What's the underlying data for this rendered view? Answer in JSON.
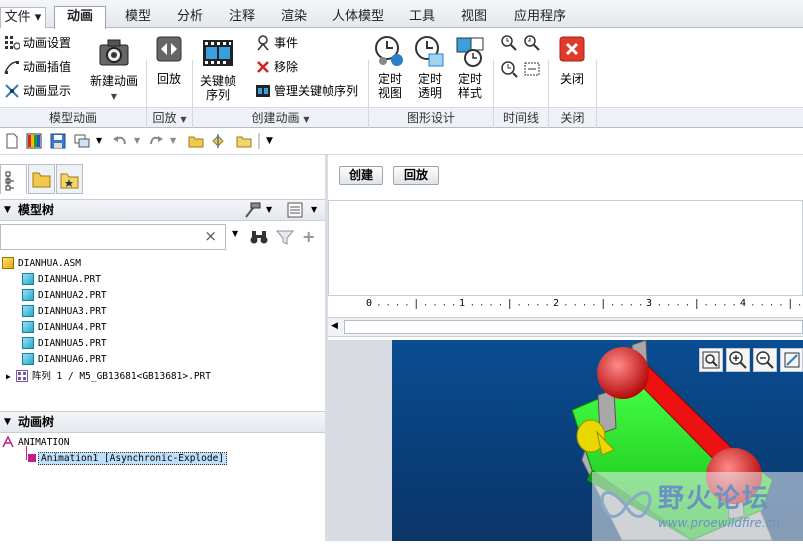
{
  "menubar": {
    "tabs": [
      {
        "label": "文件 ▾",
        "active": false
      },
      {
        "label": "动画",
        "active": true
      },
      {
        "label": "模型",
        "active": false
      },
      {
        "label": "分析",
        "active": false
      },
      {
        "label": "注释",
        "active": false
      },
      {
        "label": "渲染",
        "active": false
      },
      {
        "label": "人体模型",
        "active": false
      },
      {
        "label": "工具",
        "active": false
      },
      {
        "label": "视图",
        "active": false
      },
      {
        "label": "应用程序",
        "active": false
      }
    ]
  },
  "ribbon": {
    "model_animation": {
      "label": "模型动画",
      "anim_settings": "动画设置",
      "anim_interp": "动画插值",
      "anim_display": "动画显示",
      "new_animation": "新建动画"
    },
    "playback": {
      "label": "回放",
      "playback": "回放"
    },
    "create_animation": {
      "label": "创建动画",
      "keyframe_seq_line1": "关键帧",
      "keyframe_seq_line2": "序列",
      "event": "事件",
      "remove": "移除",
      "manage_keyframe": "管理关键帧序列"
    },
    "graphic_design": {
      "label": "图形设计",
      "timed_view_1": "定时",
      "timed_view_2": "视图",
      "timed_trans_1": "定时",
      "timed_trans_2": "透明",
      "timed_style_1": "定时",
      "timed_style_2": "样式"
    },
    "timeline": {
      "label": "时间线"
    },
    "close": {
      "label": "关闭",
      "button": "关闭"
    }
  },
  "model_tree": {
    "title": "模型树",
    "items": [
      "DIANHUA.ASM",
      "DIANHUA.PRT",
      "DIANHUA2.PRT",
      "DIANHUA3.PRT",
      "DIANHUA4.PRT",
      "DIANHUA5.PRT",
      "DIANHUA6.PRT",
      "阵列 1 / M5_GB13681<GB13681>.PRT"
    ]
  },
  "anim_tree": {
    "title": "动画树",
    "root": "ANIMATION",
    "child": "Animation1 [Asynchronic-Explode]"
  },
  "timeline_panel": {
    "create": "创建",
    "playback": "回放",
    "ruler": [
      "0",
      "1",
      "2",
      "3",
      "4"
    ]
  },
  "watermark": {
    "brand": "野火论坛",
    "url": "www.proewildfire.cn"
  },
  "colors": {
    "viewport_bg": "#0a4d92",
    "part_green": "#22ee22",
    "part_red": "#ee1111",
    "part_yellow": "#e8d800",
    "part_gray": "#a0a0a0"
  }
}
